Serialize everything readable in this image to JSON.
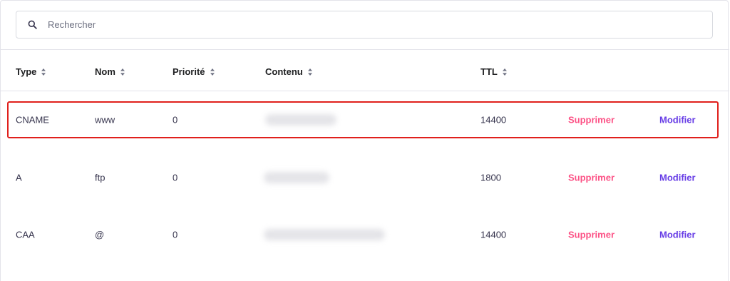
{
  "search": {
    "placeholder": "Rechercher",
    "value": ""
  },
  "table": {
    "headers": {
      "type": "Type",
      "name": "Nom",
      "priority": "Priorité",
      "content": "Contenu",
      "ttl": "TTL"
    },
    "rows": [
      {
        "type": "CNAME",
        "name": "www",
        "priority": "0",
        "ttl": "14400",
        "delete_label": "Supprimer",
        "edit_label": "Modifier"
      },
      {
        "type": "A",
        "name": "ftp",
        "priority": "0",
        "ttl": "1800",
        "delete_label": "Supprimer",
        "edit_label": "Modifier"
      },
      {
        "type": "CAA",
        "name": "@",
        "priority": "0",
        "ttl": "14400",
        "delete_label": "Supprimer",
        "edit_label": "Modifier"
      }
    ]
  },
  "colors": {
    "delete": "#fc5185",
    "edit": "#673de6",
    "highlight": "#e0201c"
  }
}
